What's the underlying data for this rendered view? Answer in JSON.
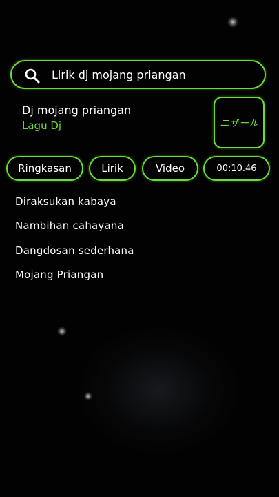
{
  "search": {
    "query": "Lirik dj mojang priangan",
    "icon": "search-icon"
  },
  "song": {
    "title": "Dj mojang priangan",
    "subtitle": "Lagu Dj",
    "thumbnail_label": "ニザール"
  },
  "tabs": [
    {
      "label": "Ringkasan"
    },
    {
      "label": "Lirik"
    },
    {
      "label": "Video"
    },
    {
      "label": "00:10.46"
    }
  ],
  "lyrics": [
    "Diraksukan kabaya",
    "Nambihan cahayana",
    "Dangdosan sederhana",
    "Mojang Priangan"
  ],
  "colors": {
    "accent": "#6fd83c",
    "background": "#020202",
    "text": "#ffffff"
  }
}
